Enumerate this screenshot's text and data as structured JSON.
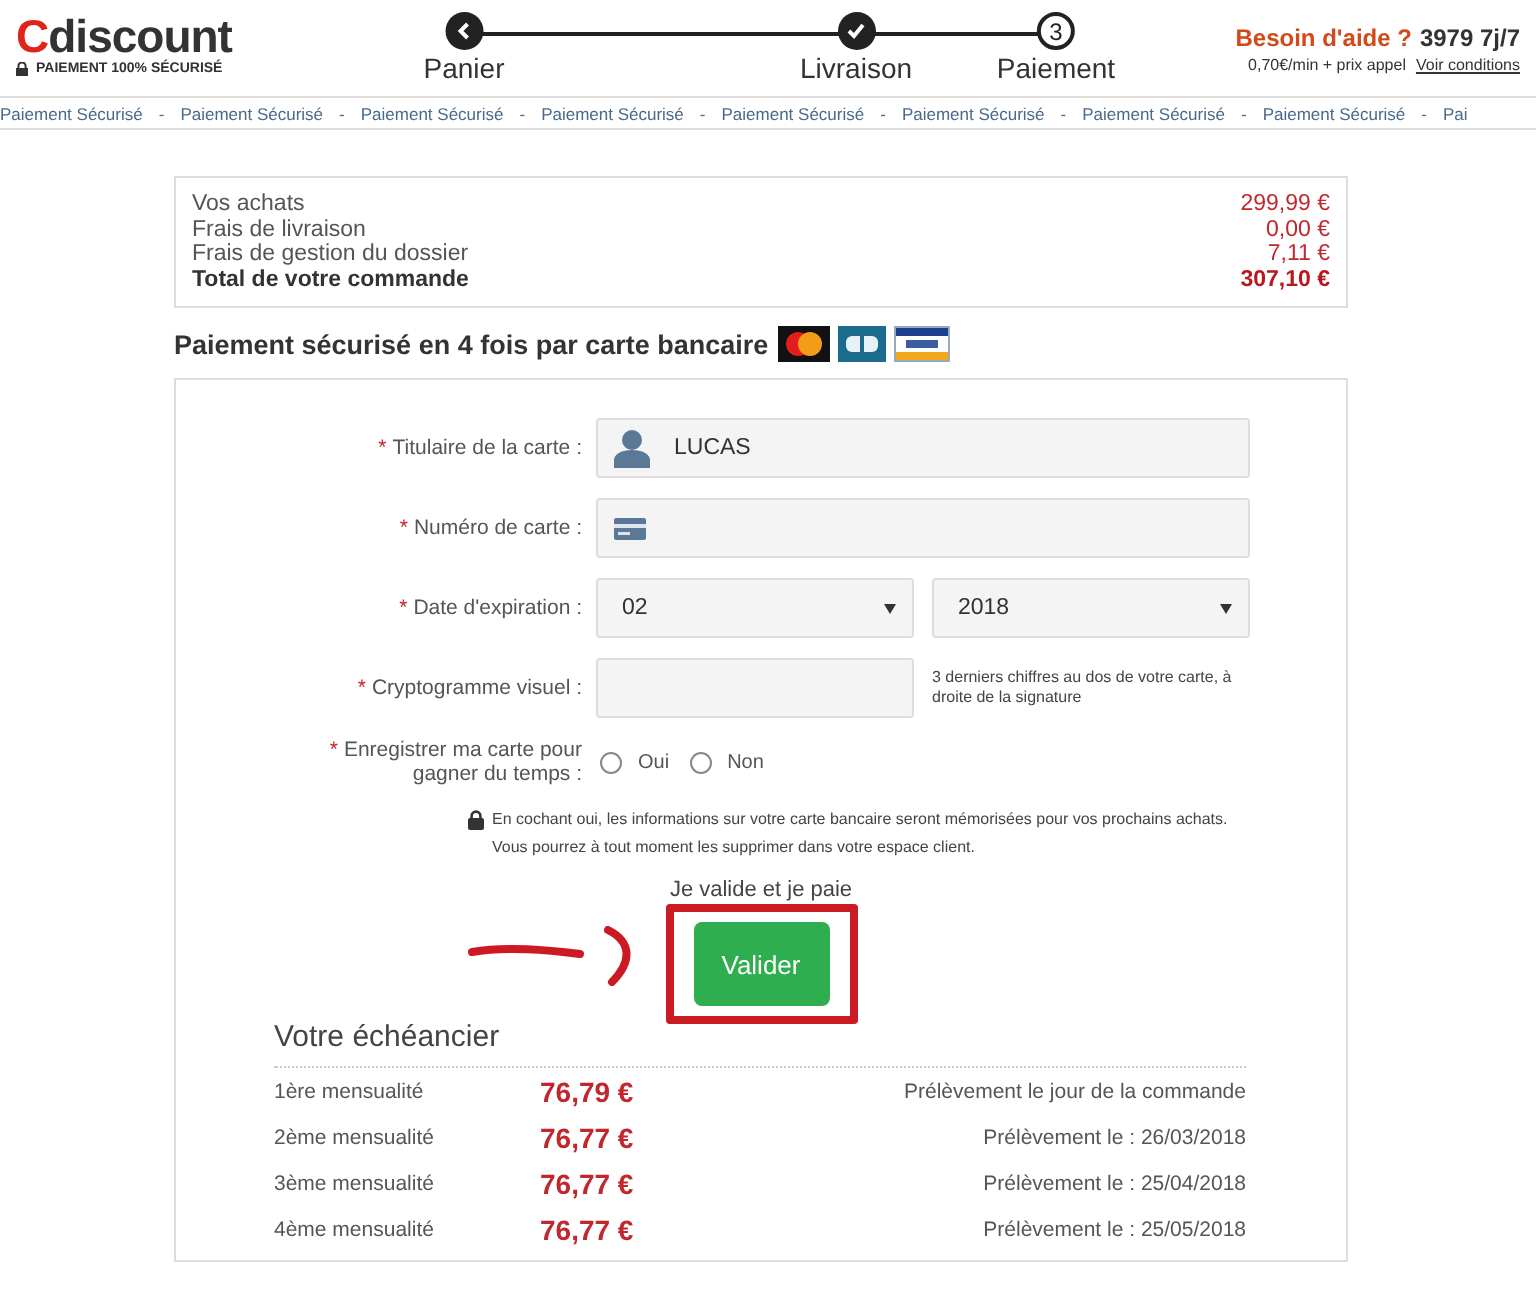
{
  "header": {
    "logo_first": "C",
    "logo_rest": "discount",
    "tagline": "PAIEMENT 100% SÉCURISÉ",
    "steps": [
      {
        "kind": "back",
        "label": "Panier"
      },
      {
        "kind": "done",
        "label": "Livraison"
      },
      {
        "kind": "current",
        "number": "3",
        "label": "Paiement"
      }
    ],
    "help": {
      "title": "Besoin d'aide ?",
      "phone": "3979 7j/7",
      "rate": "0,70€/min + prix appel",
      "link": "Voir conditions"
    }
  },
  "banner": [
    "Paiement Sécurisé",
    "Paiement Sécurisé",
    "Paiement Sécurisé",
    "Paiement Sécurisé",
    "Paiement Sécurisé",
    "Paiement Sécurisé",
    "Paiement Sécurisé",
    "Paiement Sécurisé",
    "Pai"
  ],
  "banner_separator": "-",
  "summary": [
    {
      "label": "Vos achats",
      "amount": "299,99 €",
      "total": false
    },
    {
      "label": "Frais de livraison",
      "amount": "0,00 €",
      "total": false
    },
    {
      "label": "Frais de gestion du dossier",
      "amount": "7,11 €",
      "total": false
    },
    {
      "label": "Total de votre commande",
      "amount": "307,10 €",
      "total": true
    }
  ],
  "payment_title": "Paiement sécurisé en 4 fois par carte bancaire",
  "form": [
    {
      "kind": "holder",
      "marker": "*",
      "label": "Titulaire de la carte :",
      "value": "LUCAS"
    },
    {
      "kind": "card_number",
      "marker": "*",
      "label": "Numéro de carte :"
    },
    {
      "kind": "expiry",
      "marker": "*",
      "label": "Date d'expiration :",
      "month": "02",
      "year": "2018"
    },
    {
      "kind": "cvv",
      "marker": "*",
      "label": "Cryptogramme visuel :",
      "hint": "3 derniers chiffres au dos de votre carte, à droite de la signature"
    },
    {
      "kind": "radio",
      "marker": "*",
      "label": "Enregistrer ma carte pour gagner du temps :",
      "options": [
        {
          "label": "Oui",
          "selected": false
        },
        {
          "label": "Non",
          "selected": false
        }
      ]
    }
  ],
  "notice": "En cochant oui, les informations sur votre carte bancaire seront mémorisées pour vos prochains achats. Vous pourrez à tout moment les supprimer dans votre espace client.",
  "submit": {
    "caption": "Je valide et je paie",
    "label": "Valider"
  },
  "schedule": {
    "title": "Votre échéancier",
    "rows": [
      {
        "name": "1ère mensualité",
        "amount": "76,79 €",
        "note": "Prélèvement le jour de la commande"
      },
      {
        "name": "2ème mensualité",
        "amount": "76,77 €",
        "note": "Prélèvement le : 26/03/2018"
      },
      {
        "name": "3ème mensualité",
        "amount": "76,77 €",
        "note": "Prélèvement le : 25/04/2018"
      },
      {
        "name": "4ème mensualité",
        "amount": "76,77 €",
        "note": "Prélèvement le : 25/05/2018"
      }
    ]
  }
}
